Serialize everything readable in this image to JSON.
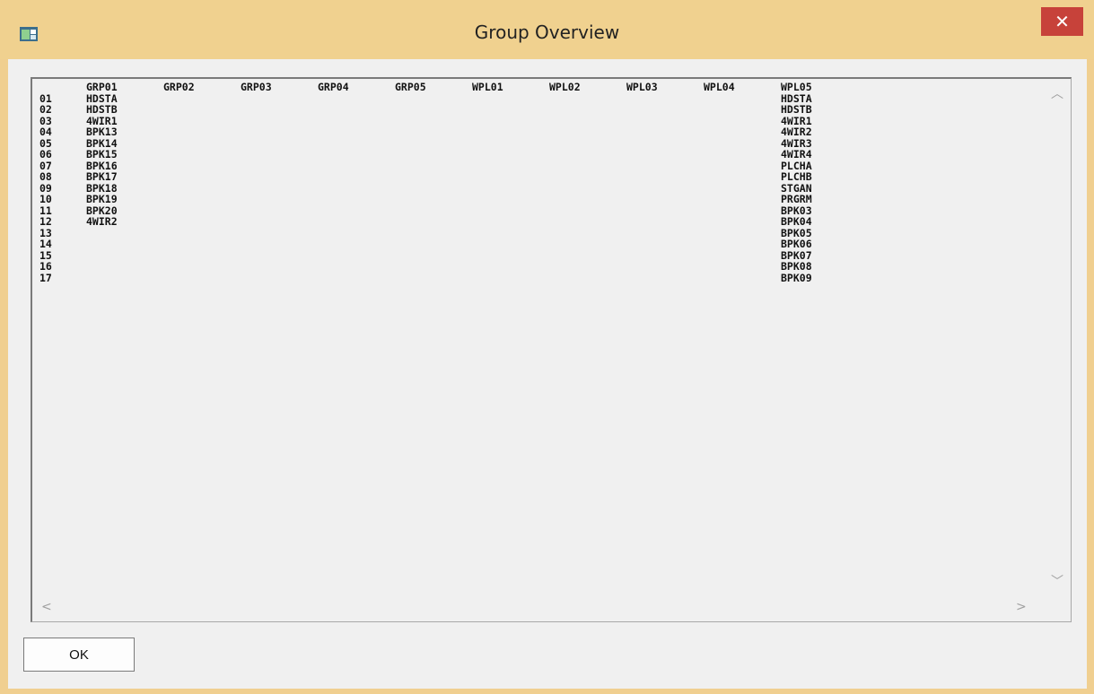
{
  "window": {
    "title": "Group Overview",
    "close_symbol": "✕",
    "accent_color": "#f0d18f",
    "close_color": "#c7423a"
  },
  "icons": {
    "app": "application-icon",
    "close": "close-icon",
    "scroll_up": "scroll-up-arrow-icon",
    "scroll_down": "scroll-down-arrow-icon",
    "scroll_left": "scroll-left-arrow-icon",
    "scroll_right": "scroll-right-arrow-icon"
  },
  "grid": {
    "columns": [
      "GRP01",
      "GRP02",
      "GRP03",
      "GRP04",
      "GRP05",
      "WPL01",
      "WPL02",
      "WPL03",
      "WPL04",
      "WPL05"
    ],
    "rows": [
      {
        "num": "01",
        "cells": [
          "HDSTA",
          "",
          "",
          "",
          "",
          "",
          "",
          "",
          "",
          "HDSTA"
        ]
      },
      {
        "num": "02",
        "cells": [
          "HDSTB",
          "",
          "",
          "",
          "",
          "",
          "",
          "",
          "",
          "HDSTB"
        ]
      },
      {
        "num": "03",
        "cells": [
          "4WIR1",
          "",
          "",
          "",
          "",
          "",
          "",
          "",
          "",
          "4WIR1"
        ]
      },
      {
        "num": "04",
        "cells": [
          "BPK13",
          "",
          "",
          "",
          "",
          "",
          "",
          "",
          "",
          "4WIR2"
        ]
      },
      {
        "num": "05",
        "cells": [
          "BPK14",
          "",
          "",
          "",
          "",
          "",
          "",
          "",
          "",
          "4WIR3"
        ]
      },
      {
        "num": "06",
        "cells": [
          "BPK15",
          "",
          "",
          "",
          "",
          "",
          "",
          "",
          "",
          "4WIR4"
        ]
      },
      {
        "num": "07",
        "cells": [
          "BPK16",
          "",
          "",
          "",
          "",
          "",
          "",
          "",
          "",
          "PLCHA"
        ]
      },
      {
        "num": "08",
        "cells": [
          "BPK17",
          "",
          "",
          "",
          "",
          "",
          "",
          "",
          "",
          "PLCHB"
        ]
      },
      {
        "num": "09",
        "cells": [
          "BPK18",
          "",
          "",
          "",
          "",
          "",
          "",
          "",
          "",
          "STGAN"
        ]
      },
      {
        "num": "10",
        "cells": [
          "BPK19",
          "",
          "",
          "",
          "",
          "",
          "",
          "",
          "",
          "PRGRM"
        ]
      },
      {
        "num": "11",
        "cells": [
          "BPK20",
          "",
          "",
          "",
          "",
          "",
          "",
          "",
          "",
          "BPK03"
        ]
      },
      {
        "num": "12",
        "cells": [
          "4WIR2",
          "",
          "",
          "",
          "",
          "",
          "",
          "",
          "",
          "BPK04"
        ]
      },
      {
        "num": "13",
        "cells": [
          "",
          "",
          "",
          "",
          "",
          "",
          "",
          "",
          "",
          "BPK05"
        ]
      },
      {
        "num": "14",
        "cells": [
          "",
          "",
          "",
          "",
          "",
          "",
          "",
          "",
          "",
          "BPK06"
        ]
      },
      {
        "num": "15",
        "cells": [
          "",
          "",
          "",
          "",
          "",
          "",
          "",
          "",
          "",
          "BPK07"
        ]
      },
      {
        "num": "16",
        "cells": [
          "",
          "",
          "",
          "",
          "",
          "",
          "",
          "",
          "",
          "BPK08"
        ]
      },
      {
        "num": "17",
        "cells": [
          "",
          "",
          "",
          "",
          "",
          "",
          "",
          "",
          "",
          "BPK09"
        ]
      }
    ]
  },
  "scrollbar": {
    "up": "︿",
    "down": "﹀",
    "left": "<",
    "right": ">"
  },
  "buttons": {
    "ok_label": "OK"
  }
}
